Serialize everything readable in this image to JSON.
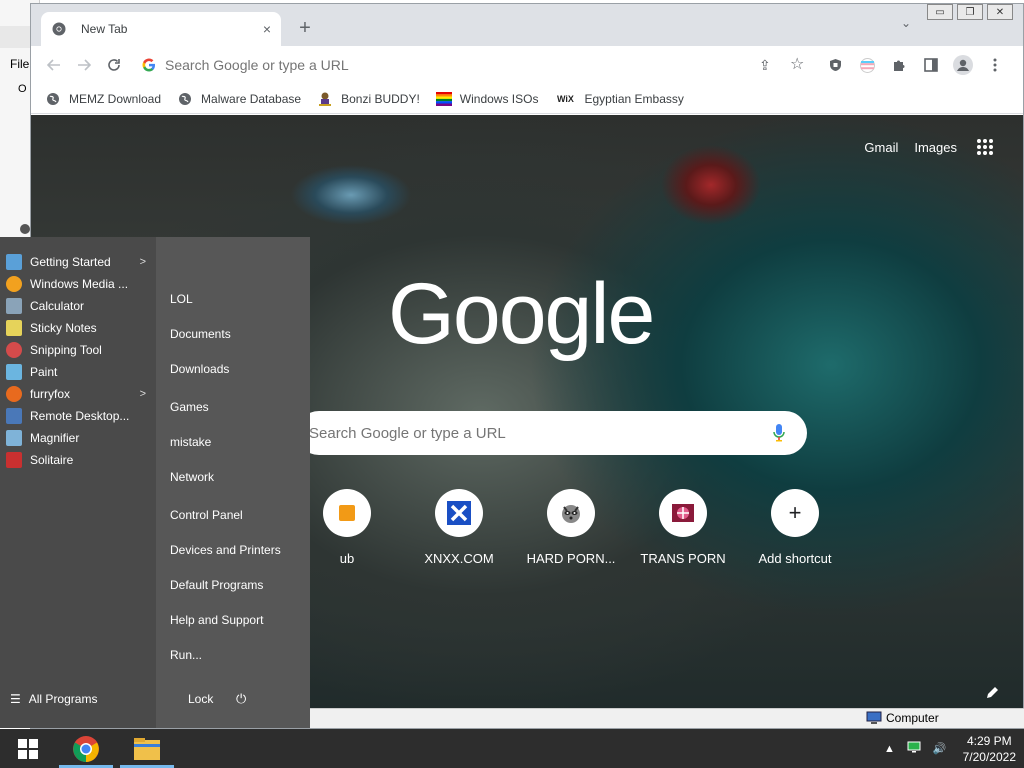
{
  "background_window": {
    "menu_label": "File",
    "letter_o": "O"
  },
  "browser": {
    "tab_title": "New Tab",
    "tab_close": "×",
    "new_tab": "+",
    "tab_search": "⌄",
    "window_controls": [
      "▭",
      "❐",
      "✕"
    ],
    "omnibox_placeholder": "Search Google or type a URL",
    "bookmarks": [
      {
        "label": "MEMZ Download",
        "icon": "globe-icon"
      },
      {
        "label": "Malware Database",
        "icon": "globe-icon"
      },
      {
        "label": "Bonzi BUDDY!",
        "icon": "bonzi-icon"
      },
      {
        "label": "Windows ISOs",
        "icon": "rainbow-icon"
      },
      {
        "label": "Egyptian Embassy",
        "icon": "wix-icon"
      }
    ],
    "wix_text": "WiX"
  },
  "ntp": {
    "gmail": "Gmail",
    "images": "Images",
    "logo": "Google",
    "search_placeholder": "Search Google or type a URL",
    "shortcuts": [
      {
        "label": "ub",
        "icon": "partial-icon"
      },
      {
        "label": "XNXX.COM",
        "icon": "x-icon"
      },
      {
        "label": "HARD PORN...",
        "icon": "raccoon-icon"
      },
      {
        "label": "TRANS PORN",
        "icon": "candy-icon"
      },
      {
        "label": "Add shortcut",
        "icon": "plus-icon"
      }
    ],
    "add_symbol": "+"
  },
  "explorer": {
    "computer_label": "Computer"
  },
  "start_menu": {
    "programs": [
      {
        "label": "Getting Started",
        "submenu": true,
        "color": "#5aa0d8"
      },
      {
        "label": "Windows Media ...",
        "submenu": false,
        "color": "#f2a11f"
      },
      {
        "label": "Calculator",
        "submenu": false,
        "color": "#8aa3b8"
      },
      {
        "label": "Sticky Notes",
        "submenu": false,
        "color": "#e6d35a"
      },
      {
        "label": "Snipping Tool",
        "submenu": false,
        "color": "#d44b4b"
      },
      {
        "label": "Paint",
        "submenu": false,
        "color": "#6bb5e0"
      },
      {
        "label": "furryfox",
        "submenu": true,
        "color": "#e86a1e"
      },
      {
        "label": "Remote Desktop...",
        "submenu": false,
        "color": "#4a78b8"
      },
      {
        "label": "Magnifier",
        "submenu": false,
        "color": "#7fb3d8"
      },
      {
        "label": "Solitaire",
        "submenu": false,
        "color": "#c93030"
      }
    ],
    "submenu_arrow": ">",
    "places": [
      "LOL",
      "Documents",
      "Downloads",
      "Games",
      "mistake",
      "Network",
      "Control Panel",
      "Devices and Printers",
      "Default Programs",
      "Help and Support",
      "Run..."
    ],
    "all_programs": "All Programs",
    "lock": "Lock",
    "power": "⏻"
  },
  "taskbar": {
    "time": "4:29 PM",
    "date": "7/20/2022",
    "tray_arrow": "▲",
    "volume": "🔊"
  }
}
